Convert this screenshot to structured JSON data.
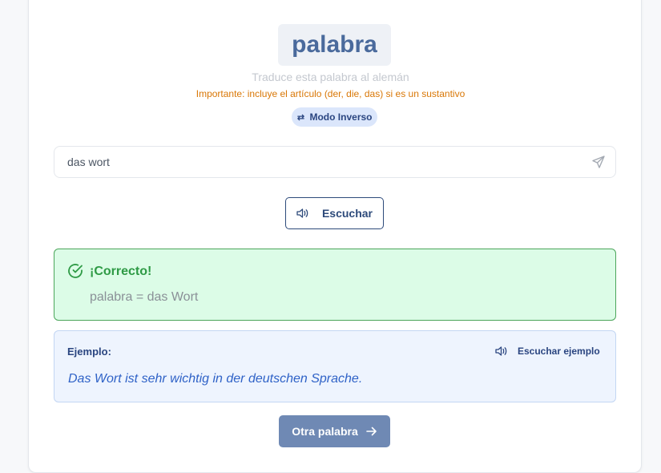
{
  "quiz": {
    "word": "palabra",
    "instruction": "Traduce esta palabra al alemán",
    "important_note": "Importante: incluye el artículo (der, die, das) si es un sustantivo",
    "mode_label": "Modo Inverso",
    "mode_icon": "swap-arrows-icon"
  },
  "answer": {
    "value": "das wort",
    "placeholder": "",
    "send_icon": "send-icon"
  },
  "listen": {
    "label": "Escuchar",
    "icon": "speaker-icon"
  },
  "result": {
    "title": "¡Correcto!",
    "translation": "palabra = das Wort",
    "icon": "check-circle-icon",
    "color": "#2e9a45"
  },
  "example": {
    "label": "Ejemplo:",
    "listen_label": "Escuchar ejemplo",
    "sentence": "Das Wort ist sehr wichtig in der deutschen Sprache."
  },
  "next": {
    "label": "Otra palabra",
    "icon": "arrow-right-icon"
  },
  "colors": {
    "accent": "#2d4a7a",
    "success_bg": "#dcfce7",
    "example_bg": "#eef4fe",
    "warning": "#d97706"
  }
}
